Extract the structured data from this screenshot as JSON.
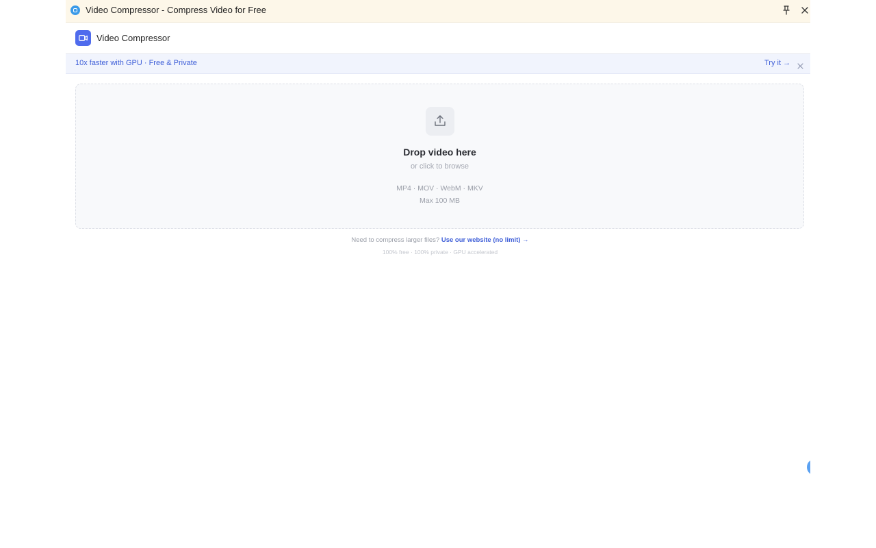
{
  "window": {
    "title": "Video Compressor - Compress Video for Free",
    "icons": {
      "app": "app-icon",
      "pin": "pin-icon",
      "close": "close-icon"
    }
  },
  "header": {
    "app_name": "Video Compressor",
    "logo_icon": "video-camera-icon"
  },
  "promo": {
    "text": "10x faster with GPU · Free & Private",
    "cta": "Try it →",
    "close_icon": "close-icon"
  },
  "dropzone": {
    "icon": "upload-icon",
    "title": "Drop video here",
    "subtitle": "or click to browse",
    "formats": "MP4 · MOV · WebM · MKV",
    "max_size": "Max 100 MB"
  },
  "footer": {
    "prompt": "Need to compress larger files?",
    "link": "Use our website (no limit) →",
    "tagline": "100% free · 100% private · GPU accelerated"
  },
  "colors": {
    "accent": "#4f6bed",
    "link": "#3f5fd8",
    "titlebar_bg": "#fdf7e9",
    "promo_bg": "#f1f4fd",
    "dropzone_bg": "#f8f9fb"
  }
}
